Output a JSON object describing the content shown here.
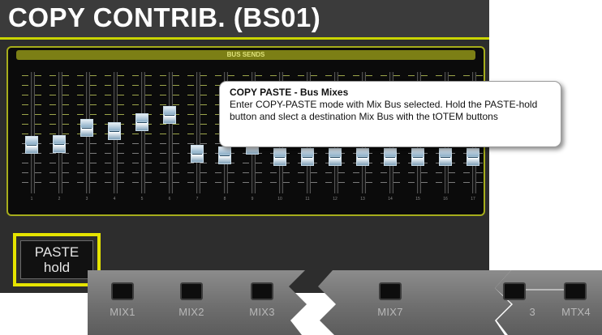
{
  "title": "COPY CONTRIB. (BS01)",
  "bus_sends": {
    "header": "BUS SENDS",
    "faders": [
      {
        "num": "1",
        "level": 0.4
      },
      {
        "num": "2",
        "level": 0.41
      },
      {
        "num": "3",
        "level": 0.56
      },
      {
        "num": "4",
        "level": 0.53
      },
      {
        "num": "5",
        "level": 0.62
      },
      {
        "num": "6",
        "level": 0.69
      },
      {
        "num": "7",
        "level": 0.31
      },
      {
        "num": "8",
        "level": 0.3
      },
      {
        "num": "9",
        "level": 0.39
      },
      {
        "num": "10",
        "level": 0.28
      },
      {
        "num": "11",
        "level": 0.28
      },
      {
        "num": "12",
        "level": 0.28
      },
      {
        "num": "13",
        "level": 0.28
      },
      {
        "num": "14",
        "level": 0.28
      },
      {
        "num": "15",
        "level": 0.28
      },
      {
        "num": "16",
        "level": 0.28
      },
      {
        "num": "17",
        "level": 0.28
      }
    ]
  },
  "callout": {
    "title": "COPY PASTE - Bus Mixes",
    "body": "Enter COPY-PASTE mode with Mix Bus selected. Hold the PASTE-hold button and slect a destination Mix Bus with the tOTEM buttons"
  },
  "paste_button": {
    "line1": "PASTE",
    "line2": "hold"
  },
  "mix_buttons": [
    {
      "label": "MIX1"
    },
    {
      "label": "MIX2"
    },
    {
      "label": "MIX3"
    },
    {
      "label": "MIX7"
    },
    {
      "label": "3"
    },
    {
      "label": "MTX4"
    }
  ]
}
